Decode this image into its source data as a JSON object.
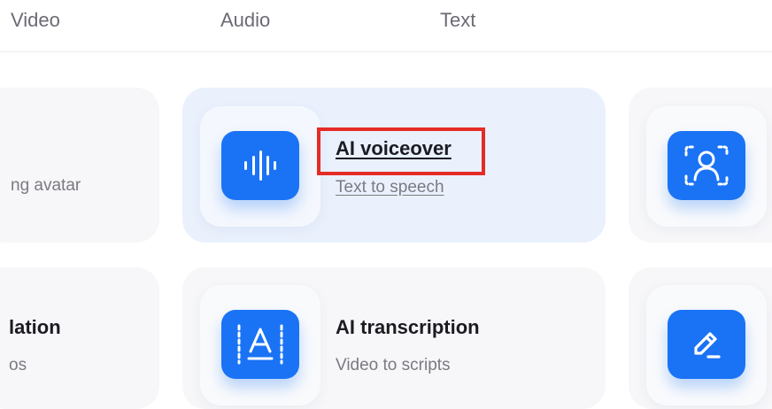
{
  "tabs": [
    {
      "label": "Video"
    },
    {
      "label": "Audio"
    },
    {
      "label": "Text"
    }
  ],
  "cards": {
    "avatar": {
      "subtitle": "ng avatar",
      "icon": "waveform-icon"
    },
    "voiceover": {
      "title": "AI voiceover",
      "subtitle": "Text to speech",
      "icon": "waveform-icon"
    },
    "clone": {
      "icon": "person-frame-icon"
    },
    "translation": {
      "title": "lation",
      "subtitle": "os"
    },
    "transcription": {
      "title": "AI transcription",
      "subtitle": "Video to scripts",
      "icon": "text-a-icon"
    },
    "edit": {
      "icon": "pencil-icon"
    }
  },
  "colors": {
    "accent": "#1a73f5",
    "active_card": "#eaf1fd",
    "card": "#f7f7f9",
    "highlight": "#e52b26"
  }
}
